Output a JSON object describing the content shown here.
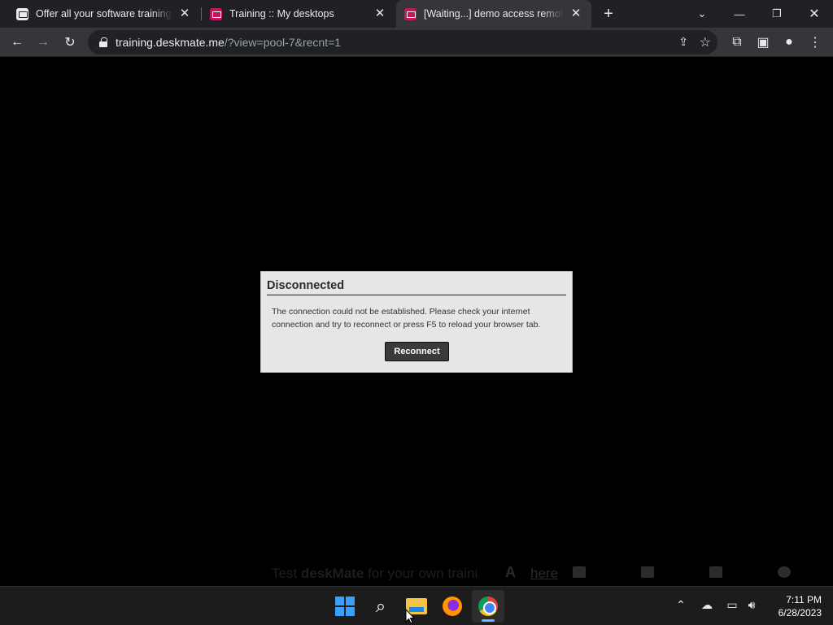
{
  "browser": {
    "tabs": [
      {
        "title": "Offer all your software trainings a",
        "active": false
      },
      {
        "title": "Training :: My desktops",
        "active": false
      },
      {
        "title": "[Waiting...] demo access remote t",
        "active": true
      }
    ],
    "address": {
      "host": "training.deskmate.me",
      "path": "/?view=pool-7&recnt=1"
    }
  },
  "dialog": {
    "title": "Disconnected",
    "message": "The connection could not be established. Please check your internet connection and try to reconnect or press F5 to reload your browser tab.",
    "button_label": "Reconnect"
  },
  "footer": {
    "text_before": "Test ",
    "brand": "deskMate",
    "text_after": " for your own traini",
    "link_label": "here"
  },
  "taskbar": {
    "apps": [
      "windows-start",
      "search",
      "file-explorer",
      "firefox",
      "chrome"
    ],
    "active_app": "chrome",
    "clock_time": "7:11 PM",
    "clock_date": "6/28/2023"
  }
}
